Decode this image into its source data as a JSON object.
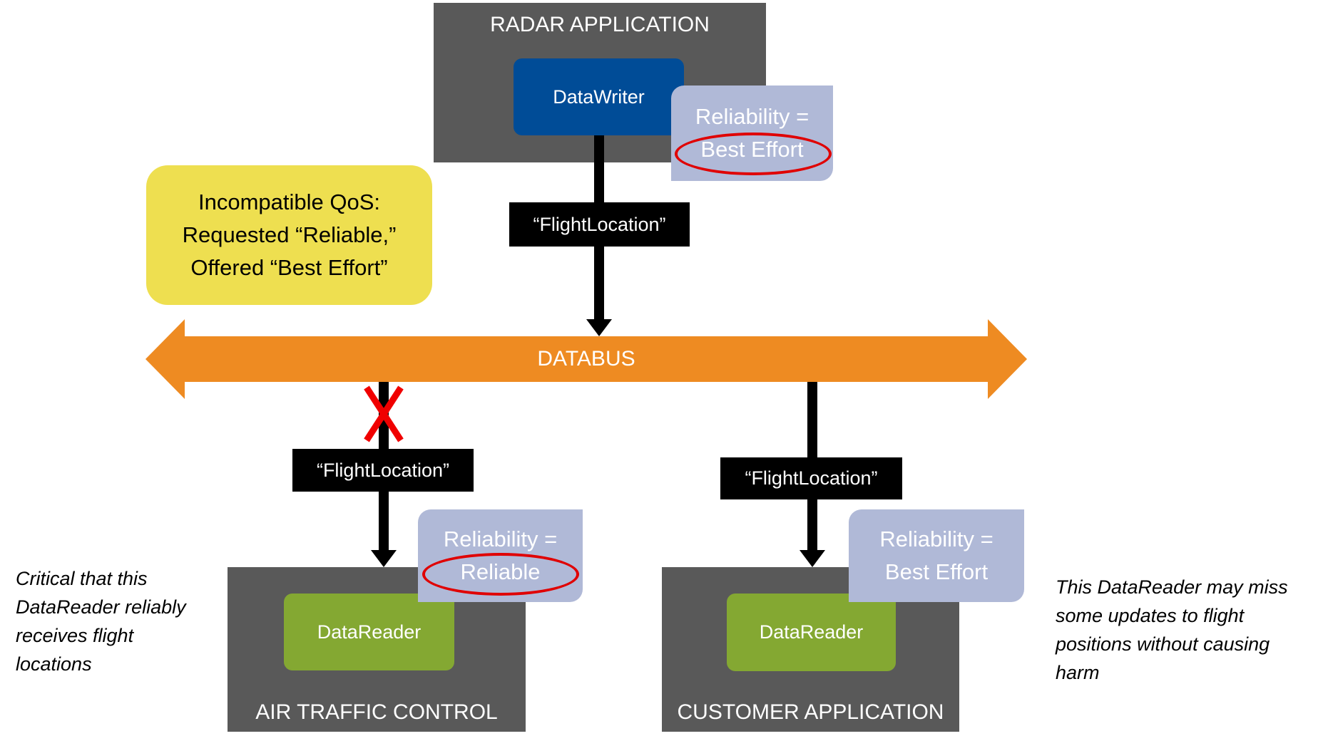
{
  "radar_app": {
    "title": "RADAR APPLICATION",
    "writer_label": "DataWriter",
    "reliability_line1": "Reliability =",
    "reliability_line2": "Best Effort"
  },
  "topic_top": "“FlightLocation”",
  "warning": {
    "line1": "Incompatible QoS:",
    "line2": "Requested “Reliable,”",
    "line3": "Offered “Best Effort”"
  },
  "databus": {
    "label": "DATABUS"
  },
  "atc_app": {
    "title": "AIR TRAFFIC CONTROL",
    "reader_label": "DataReader",
    "reliability_line1": "Reliability =",
    "reliability_line2": "Reliable",
    "topic": "“FlightLocation”"
  },
  "customer_app": {
    "title": "CUSTOMER APPLICATION",
    "reader_label": "DataReader",
    "reliability_line1": "Reliability =",
    "reliability_line2": "Best Effort",
    "topic": "“FlightLocation”"
  },
  "notes": {
    "left": [
      "Critical that this",
      "DataReader reliably",
      "receives flight",
      "locations"
    ],
    "right": [
      "This DataReader may miss",
      "some updates to flight",
      "positions without causing",
      "harm"
    ]
  },
  "colors": {
    "app_box": "#595959",
    "writer": "#004C97",
    "reader": "#84A832",
    "qos_box": "#B0B9D7",
    "databus": "#EE8B22",
    "warning": "#EEDF50",
    "highlight": "#E00000"
  }
}
